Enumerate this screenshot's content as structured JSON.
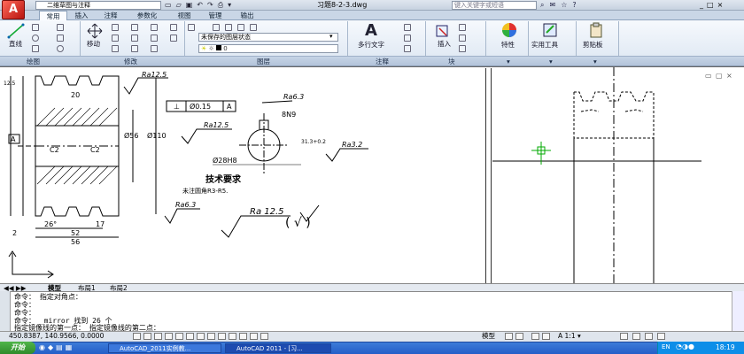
{
  "titlebar": {
    "workspace": "二维草图与注释",
    "document_title": "习题8-2-3.dwg",
    "search_placeholder": "键入关键字或短语",
    "window_controls": [
      "_",
      "□",
      "×"
    ]
  },
  "ribbon_tabs": [
    "常用",
    "插入",
    "注释",
    "参数化",
    "视图",
    "管理",
    "输出"
  ],
  "ribbon": {
    "draw": {
      "line_label": "直线",
      "panel_label": "绘图"
    },
    "modify": {
      "move_label": "移动",
      "panel_label": "修改"
    },
    "layers": {
      "layer_state": "未保存的图层状态",
      "current_layer": "0",
      "panel_label": "图层"
    },
    "annotation": {
      "mtext_label": "多行文字",
      "panel_label": "注释"
    },
    "block": {
      "insert_label": "插入",
      "panel_label": "块"
    },
    "properties_label": "特性",
    "utilities_label": "实用工具",
    "clipboard_label": "剪贴板"
  },
  "drawing": {
    "surface_roughness": [
      "Ra12.5",
      "Ra6.3",
      "Ra12.5",
      "Ra3.2",
      "Ra6.3",
      "Ra12.5",
      "Ra12.5",
      "Ra3.2"
    ],
    "tolerance": {
      "symbol": "⊥",
      "value": "Ø0.15",
      "datum": "A"
    },
    "datum_label": "A",
    "dims": [
      "20",
      "52",
      "56",
      "17",
      "26°",
      "2",
      "C2",
      "C2",
      "Ø56",
      "Ø110",
      "Ø28H8",
      "8N9",
      "31.3+0.2",
      "12.5"
    ],
    "tech_title": "技术要求",
    "tech_note": "未注圆角R3-R5.",
    "roughness_big": "Ra 12.5",
    "roughness_paren": "( √ )"
  },
  "layout_tabs": [
    "模型",
    "布局1",
    "布局2"
  ],
  "command_history": [
    "命令： 指定对角点：",
    "命令：",
    "命令：",
    "命令： _mirror 找到 26 个",
    "指定镜像线的第一点： 指定镜像线的第二点："
  ],
  "status": {
    "coords": "450.8387, 140.9566, 0.0000",
    "space": "模型",
    "scale": "A 1:1 ▾"
  },
  "taskbar": {
    "start_label": "开始",
    "tasks": [
      "AutoCAD_2011实例教...",
      "AutoCAD 2011 - [习..."
    ],
    "clock": "18:19"
  },
  "colors": {
    "accent": "#c8d6e8",
    "crosshair": "#00aa00",
    "taskbar": "#245ec8"
  }
}
